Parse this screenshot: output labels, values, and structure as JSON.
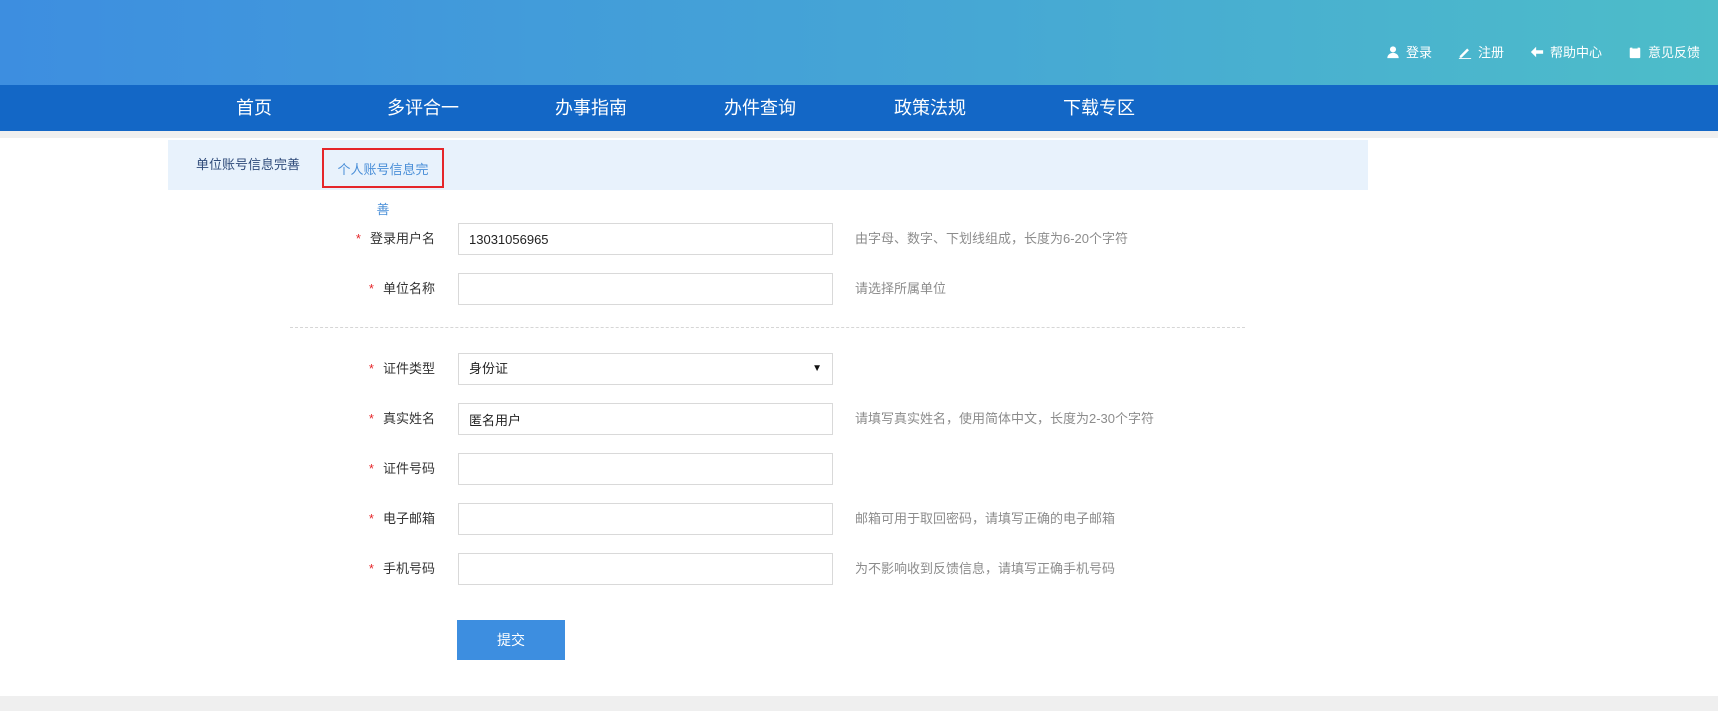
{
  "top_links": [
    {
      "label": "登录",
      "icon": "user-icon"
    },
    {
      "label": "注册",
      "icon": "pencil-icon"
    },
    {
      "label": "帮助中心",
      "icon": "help-arrow-icon"
    },
    {
      "label": "意见反馈",
      "icon": "feedback-icon"
    }
  ],
  "nav": [
    "首页",
    "多评合一",
    "办事指南",
    "办件查询",
    "政策法规",
    "下载专区"
  ],
  "tabs": {
    "company": "单位账号信息完善",
    "personal": "个人账号信息完善"
  },
  "form": {
    "username": {
      "label": "登录用户名",
      "value": "13031056965",
      "hint": "由字母、数字、下划线组成，长度为6-20个字符"
    },
    "unit": {
      "label": "单位名称",
      "value": "",
      "hint": "请选择所属单位"
    },
    "id_type": {
      "label": "证件类型",
      "value": "身份证"
    },
    "real_name": {
      "label": "真实姓名",
      "value": "匿名用户",
      "hint": "请填写真实姓名，使用简体中文，长度为2-30个字符"
    },
    "id_number": {
      "label": "证件号码",
      "value": ""
    },
    "email": {
      "label": "电子邮箱",
      "value": "",
      "hint": "邮箱可用于取回密码，请填写正确的电子邮箱"
    },
    "phone": {
      "label": "手机号码",
      "value": "",
      "hint": "为不影响收到反馈信息，请填写正确手机号码"
    }
  },
  "required_mark": "*",
  "submit_label": "提交",
  "colors": {
    "nav_bg": "#1367c6",
    "accent": "#3d8ee0",
    "required": "#e5262a",
    "tab_bg": "#e8f2fc"
  }
}
